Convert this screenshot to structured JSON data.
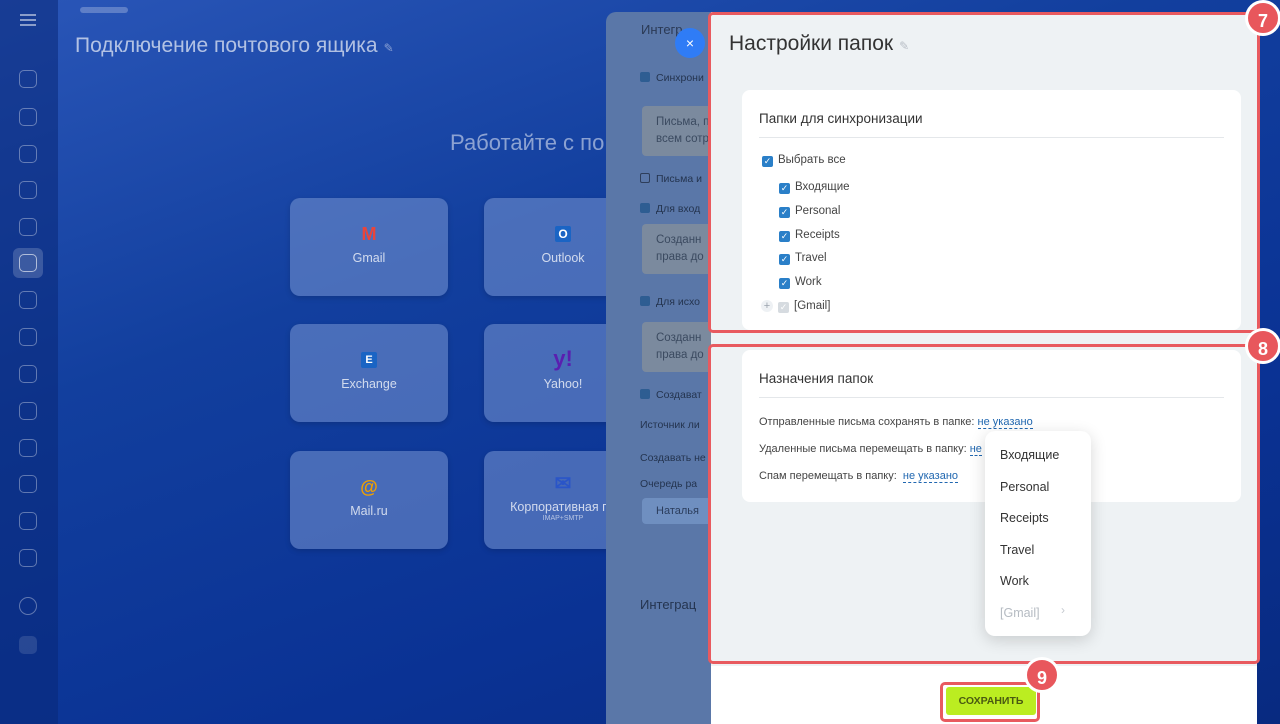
{
  "background": {
    "page_title": "Подключение почтового ящика",
    "pin_icon": "pin-icon",
    "subtitle": "Работайте с по",
    "services": [
      {
        "label": "Gmail",
        "icon": "M",
        "icon_color": "#e8453c"
      },
      {
        "label": "Outlook",
        "icon": "O",
        "icon_color": "#1a64c4"
      },
      {
        "label": "Exchange",
        "icon": "E",
        "icon_color": "#1a64c4"
      },
      {
        "label": "Yahoo!",
        "icon": "y!",
        "icon_color": "#5a1fb0"
      },
      {
        "label": "Mail.ru",
        "icon": "@",
        "icon_color": "#f0a000"
      },
      {
        "label": "Корпоративная по",
        "sub": "IMAP+SMTP",
        "icon": "✉",
        "icon_color": "#2a55c8"
      }
    ]
  },
  "integration_panel": {
    "title": "Интегр",
    "rows": [
      {
        "label": "Синхрони",
        "checked": true
      },
      {
        "label": "Письма и",
        "checked": false
      },
      {
        "label": "Для вход",
        "checked": true
      },
      {
        "label": "Для исхо",
        "checked": true
      },
      {
        "label": "Создават",
        "checked": true
      },
      {
        "label": "Источник ли",
        "checked": null
      },
      {
        "label": "Создавать не",
        "checked": null
      },
      {
        "label": "Очередь ра",
        "checked": null
      }
    ],
    "boxes": [
      {
        "line1": "Письма, п",
        "line2": "всем сотр"
      },
      {
        "line1": "Созданн",
        "line2": "права до"
      },
      {
        "line1": "Созданн",
        "line2": "права до"
      }
    ],
    "queue_button": "Наталья",
    "section2": "Интеграц"
  },
  "close_button": "×",
  "folder_settings": {
    "title": "Настройки папок",
    "sync_card": {
      "heading": "Папки для синхронизации",
      "select_all": "Выбрать все",
      "folders": [
        "Входящие",
        "Personal",
        "Receipts",
        "Travel",
        "Work"
      ],
      "gmail_folder": "[Gmail]"
    },
    "assign_card": {
      "heading": "Назначения папок",
      "sent_label": "Отправленные письма сохранять в папке:",
      "sent_value": "не указано",
      "deleted_label": "Удаленные письма перемещать в папку:",
      "deleted_value": "не",
      "spam_label": "Спам перемещать в папку:",
      "spam_value": "не указано"
    },
    "dropdown": {
      "items": [
        "Входящие",
        "Personal",
        "Receipts",
        "Travel",
        "Work"
      ],
      "disabled_item": "[Gmail]"
    },
    "save_button": "СОХРАНИТЬ"
  },
  "annotations": {
    "badge_7": "7",
    "badge_8": "8",
    "badge_9": "9",
    "highlight_color": "#e85a5f"
  }
}
